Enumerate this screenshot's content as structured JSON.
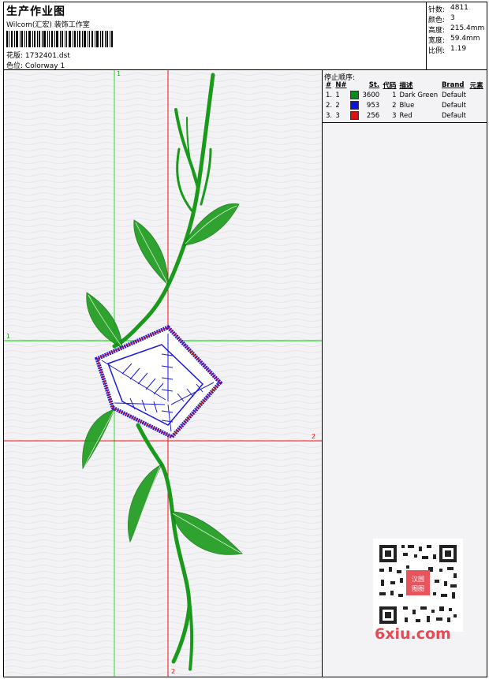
{
  "header": {
    "title": "生产作业图",
    "subtitle": "Wilcom(汇宏) 装饰工作室",
    "design_label": "花版:",
    "design_value": "1732401.dst",
    "colorway_label": "色位:",
    "colorway_value": "Colorway 1"
  },
  "stats": [
    {
      "label": "针数:",
      "value": "4811"
    },
    {
      "label": "颜色:",
      "value": "3"
    },
    {
      "label": "高度:",
      "value": "215.4mm"
    },
    {
      "label": "宽度:",
      "value": "59.4mm"
    },
    {
      "label": "比例:",
      "value": "1.19"
    }
  ],
  "stop_sequence": {
    "title": "停止顺序:",
    "columns": [
      "#",
      "N#",
      "St.",
      "代码",
      "描述",
      "Brand",
      "元素"
    ],
    "rows": [
      {
        "num": "1.",
        "n": "1",
        "color": "#0a8a1a",
        "st": "3600",
        "code": "1",
        "desc": "Dark Green",
        "brand": "Default"
      },
      {
        "num": "2.",
        "n": "2",
        "color": "#1010e0",
        "st": "953",
        "code": "2",
        "desc": "Blue",
        "brand": "Default"
      },
      {
        "num": "3.",
        "n": "3",
        "color": "#e01010",
        "st": "256",
        "code": "3",
        "desc": "Red",
        "brand": "Default"
      }
    ]
  },
  "guides": {
    "green_v": "1",
    "green_h": "1",
    "red_h": "2",
    "red_v": "2"
  },
  "watermark": {
    "logo_text": "6xiu.com",
    "stamp_text": "汉国图图"
  },
  "colors": {
    "stitch_green": "#1a9a1a",
    "stitch_blue": "#1a1ae0",
    "stitch_red": "#e01010",
    "guide_green": "#22dd22",
    "guide_red": "#ee1111"
  }
}
